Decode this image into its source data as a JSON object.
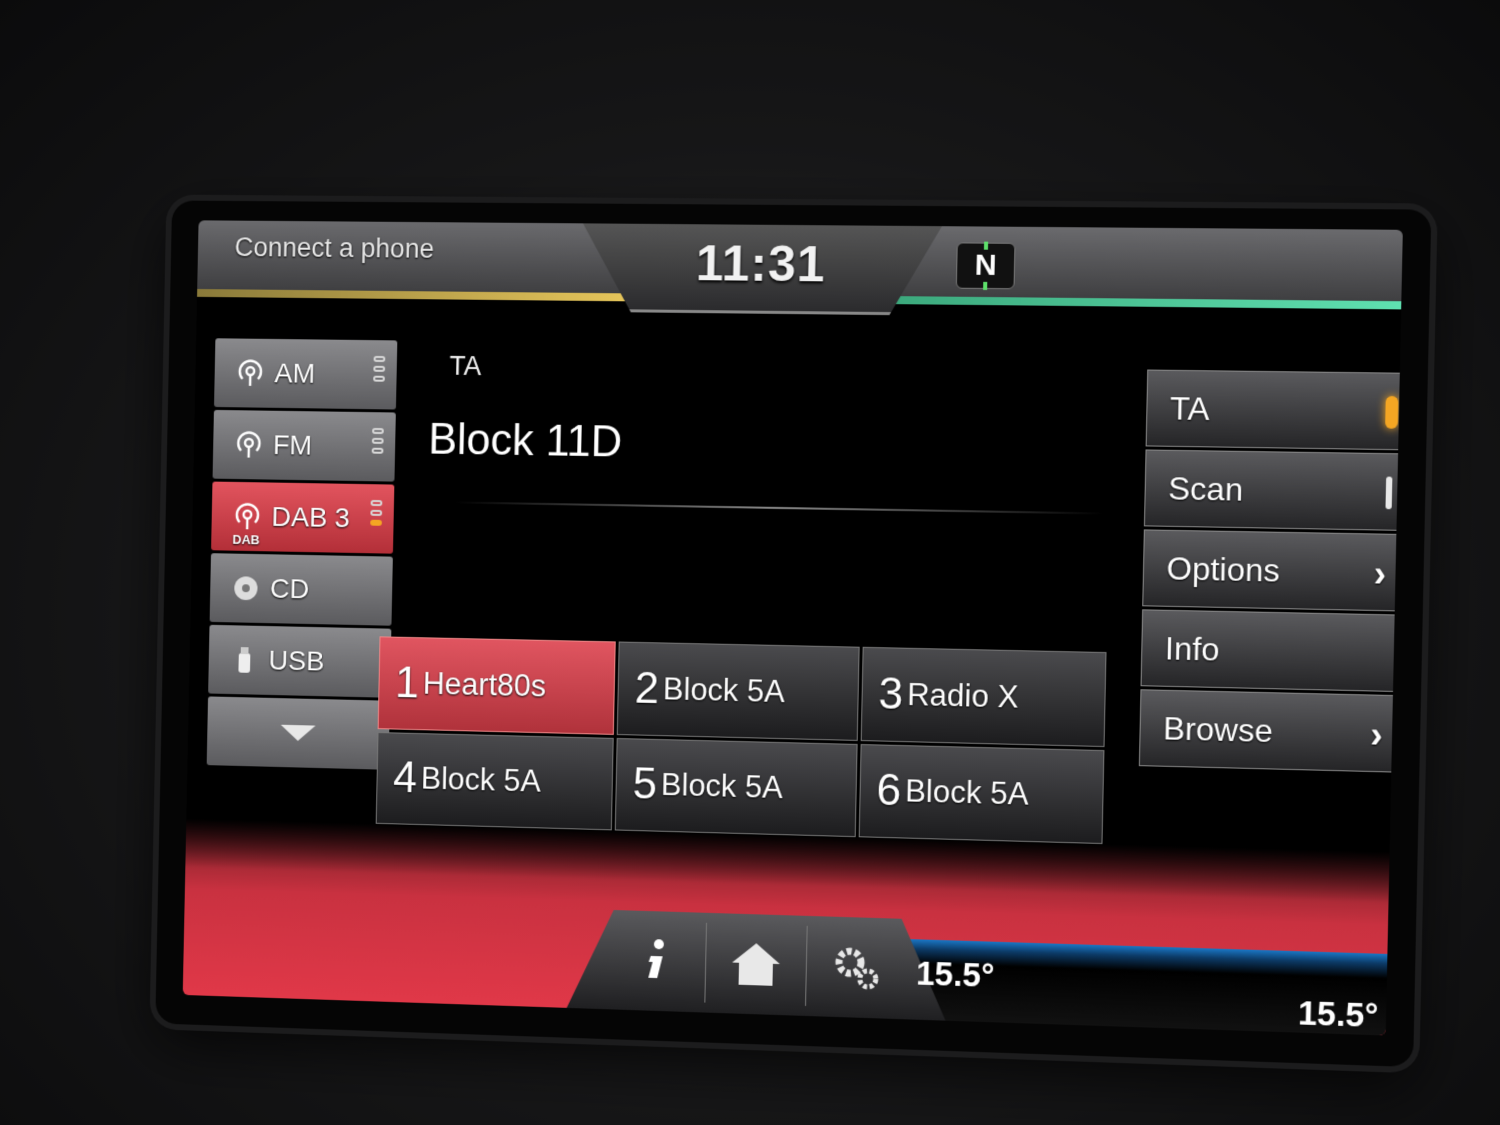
{
  "header": {
    "phone_status": "Connect a phone",
    "clock": "11:31",
    "compass": "N"
  },
  "sources": [
    {
      "label": "AM",
      "icon": "antenna-icon"
    },
    {
      "label": "FM",
      "icon": "antenna-icon"
    },
    {
      "label": "DAB 3",
      "sub": "DAB",
      "icon": "antenna-icon",
      "active": true
    },
    {
      "label": "CD",
      "icon": "disc-icon"
    },
    {
      "label": "USB",
      "icon": "usb-icon"
    }
  ],
  "main": {
    "ta_label": "TA",
    "station_name": "Block 11D"
  },
  "presets": [
    {
      "num": "1",
      "name": "Heart80s",
      "selected": true
    },
    {
      "num": "2",
      "name": "Block 5A"
    },
    {
      "num": "3",
      "name": "Radio X"
    },
    {
      "num": "4",
      "name": "Block 5A"
    },
    {
      "num": "5",
      "name": "Block 5A"
    },
    {
      "num": "6",
      "name": "Block 5A"
    }
  ],
  "right_buttons": {
    "ta": "TA",
    "scan": "Scan",
    "options": "Options",
    "info": "Info",
    "browse": "Browse"
  },
  "bottom": {
    "temp_driver": "15.5°",
    "temp_passenger": "15.5°"
  },
  "colors": {
    "accent_red": "#c93140",
    "indicator_amber": "#f4a623",
    "accent_blue": "#1a76c4"
  }
}
